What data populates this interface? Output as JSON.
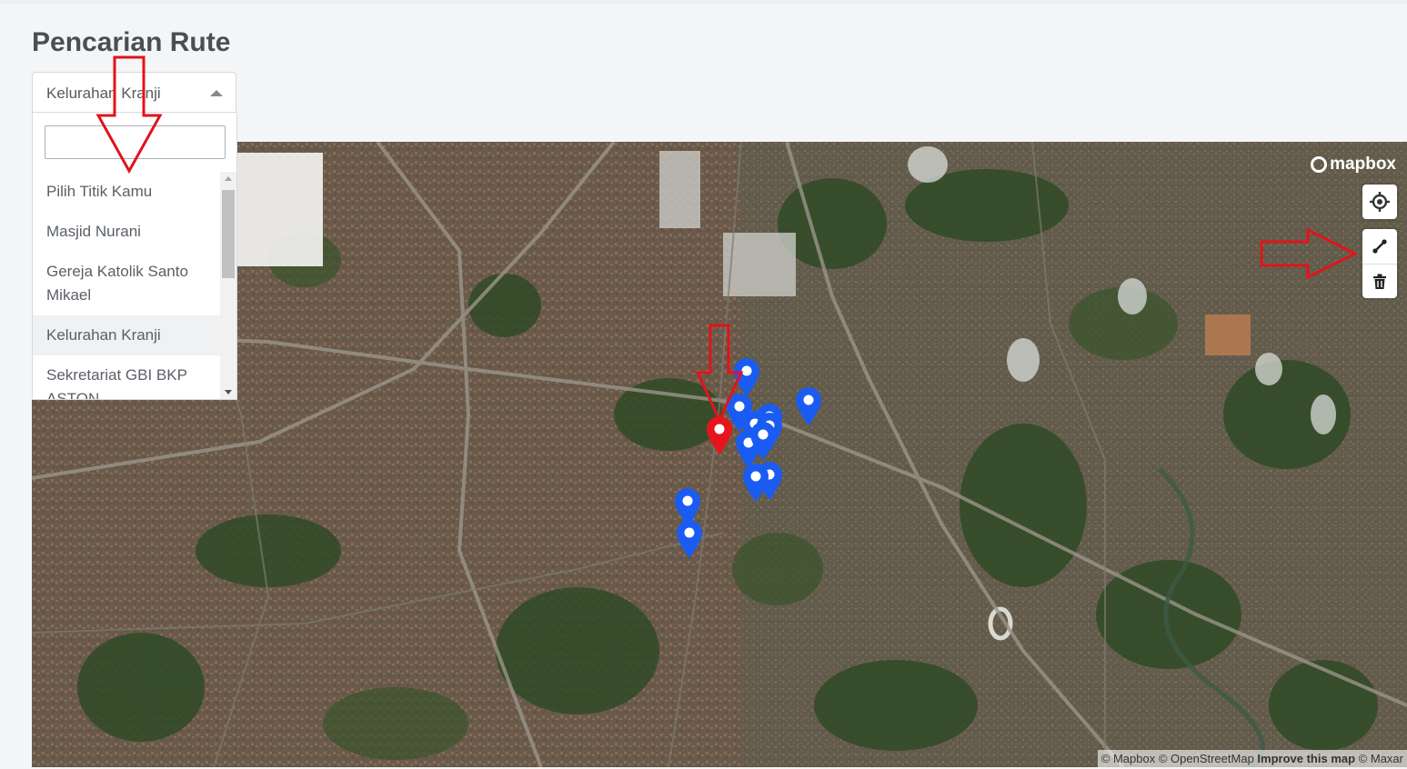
{
  "page": {
    "title": "Pencarian Rute"
  },
  "location_select": {
    "selected_value": "Kelurahan Kranji",
    "search_value": "",
    "options": [
      {
        "label": "Pilih Titik Kamu"
      },
      {
        "label": "Masjid Nurani"
      },
      {
        "label": "Gereja Katolik Santo Mikael"
      },
      {
        "label": "Kelurahan Kranji"
      },
      {
        "label": "Sekretariat GBI BKP ASTON"
      }
    ],
    "highlighted_option": "Kelurahan Kranji"
  },
  "map": {
    "logo_text": "mapbox",
    "controls": [
      {
        "icon": "geolocate-icon"
      },
      {
        "icon": "draw-line-icon"
      },
      {
        "icon": "trash-icon"
      }
    ],
    "attribution": {
      "mapbox": "© Mapbox",
      "osm": "© OpenStreetMap",
      "improve": "Improve this map",
      "maxar": "© Maxar"
    },
    "markers": {
      "selected_color": "#e8141c",
      "default_color": "#1a5cf2",
      "selected_count": 1,
      "default_count": 12
    }
  },
  "annotations": {
    "arrow_color": "#e0141b"
  }
}
